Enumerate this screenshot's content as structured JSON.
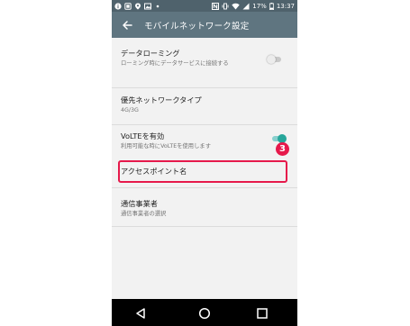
{
  "status_bar": {
    "battery_percent": "17%",
    "time": "13:37",
    "left_icons": [
      "info-icon",
      "storage-icon",
      "location-icon",
      "photo-icon",
      "more-dots-icon"
    ],
    "right_icons": [
      "nfc-icon",
      "vibrate-icon",
      "wifi-icon",
      "signal-icon",
      "battery-icon"
    ]
  },
  "app_bar": {
    "title": "モバイルネットワーク設定"
  },
  "settings": [
    {
      "label": "データローミング",
      "sub": "ローミング時にデータサービスに接続する",
      "toggle": "off"
    },
    {
      "label": "優先ネットワークタイプ",
      "sub": "4G/3G"
    },
    {
      "label": "VoLTEを有効",
      "sub": "利用可能な時にVoLTEを使用します",
      "toggle": "on"
    },
    {
      "label": "アクセスポイント名",
      "highlighted": true
    },
    {
      "label": "通信事業者",
      "sub": "通信事業者の選択"
    }
  ],
  "annotation": {
    "step_number": "3",
    "highlight_color": "#e6194b"
  },
  "colors": {
    "status_bar": "#4f626c",
    "app_bar": "#5f7580",
    "toggle_on": "#26a69a",
    "background": "#f2f2f2"
  },
  "nav_bar": [
    "back-icon",
    "home-icon",
    "recents-icon"
  ]
}
